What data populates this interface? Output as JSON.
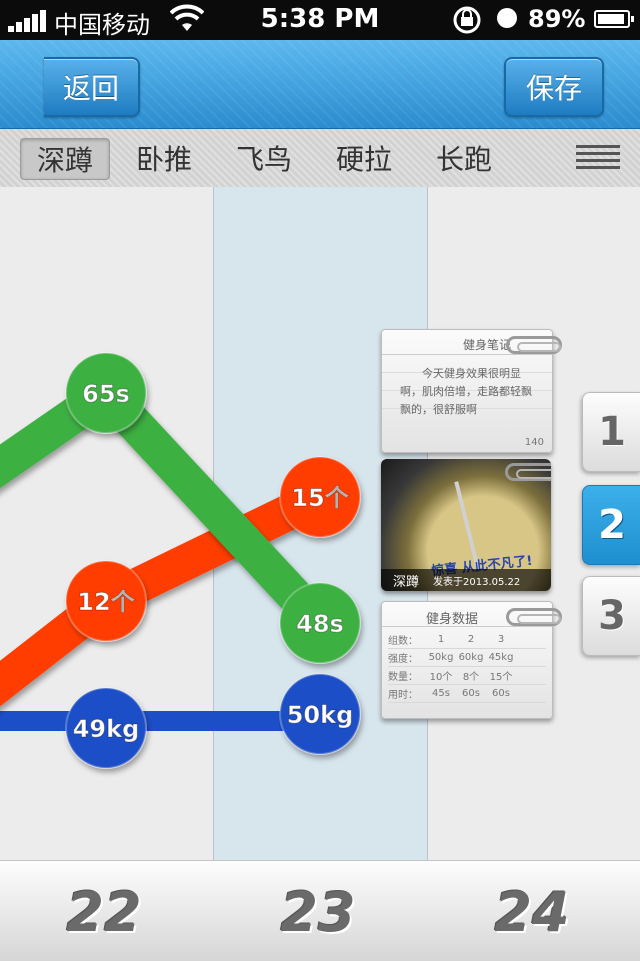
{
  "status_bar": {
    "carrier": "中国移动",
    "time": "5:38 PM",
    "battery_percent": "89%"
  },
  "nav": {
    "back_label": "返回",
    "save_label": "保存"
  },
  "tabs": [
    {
      "label": "深蹲",
      "active": true
    },
    {
      "label": "卧推",
      "active": false
    },
    {
      "label": "飞鸟",
      "active": false
    },
    {
      "label": "硬拉",
      "active": false
    },
    {
      "label": "长跑",
      "active": false
    }
  ],
  "chart_data": {
    "type": "line",
    "x": [
      "22",
      "23",
      "24"
    ],
    "series": [
      {
        "values": [
          "65s",
          "48s"
        ],
        "color": "#3cb043"
      },
      {
        "values": [
          "12个",
          "15个"
        ],
        "color": "#ff3d00"
      },
      {
        "values": [
          "49kg",
          "50kg"
        ],
        "color": "#1f4fc7"
      }
    ]
  },
  "cards": {
    "note": {
      "title": "健身笔记",
      "body": "今天健身效果很明显啊，肌肉倍增，走路都轻飘飘的，很舒服啊",
      "count": "140"
    },
    "photo": {
      "caption": "深蹲",
      "date": "发表于2013.05.22",
      "dial_text": "惊喜 从此不凡了!"
    },
    "data": {
      "title": "健身数据",
      "rows": [
        {
          "key": "组数：",
          "values": [
            "1",
            "2",
            "3"
          ]
        },
        {
          "key": "强度：",
          "values": [
            "50kg",
            "60kg",
            "45kg"
          ]
        },
        {
          "key": "数量：",
          "values": [
            "10个",
            "8个",
            "15个"
          ]
        },
        {
          "key": "用时：",
          "values": [
            "45s",
            "60s",
            "60s"
          ]
        }
      ]
    }
  },
  "page_tabs": [
    {
      "label": "1",
      "active": false
    },
    {
      "label": "2",
      "active": true
    },
    {
      "label": "3",
      "active": false
    }
  ],
  "dates": [
    "22",
    "23",
    "24"
  ]
}
